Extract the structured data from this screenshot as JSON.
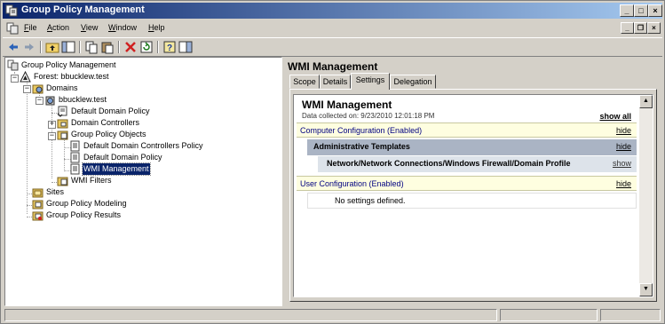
{
  "window": {
    "title": "Group Policy Management"
  },
  "menu": {
    "items": [
      "File",
      "Action",
      "View",
      "Window",
      "Help"
    ]
  },
  "tree": {
    "root": "Group Policy Management",
    "forest": "Forest: bbucklew.test",
    "domains": "Domains",
    "domain": "bbucklew.test",
    "default_domain_policy": "Default Domain Policy",
    "domain_controllers": "Domain Controllers",
    "gpo_container": "Group Policy Objects",
    "gpo_ddcp": "Default Domain Controllers Policy",
    "gpo_ddp": "Default Domain Policy",
    "gpo_wmi": "WMI Management",
    "wmi_filters": "WMI Filters",
    "sites": "Sites",
    "modeling": "Group Policy Modeling",
    "results": "Group Policy Results"
  },
  "details": {
    "title": "WMI Management",
    "tabs": [
      "Scope",
      "Details",
      "Settings",
      "Delegation"
    ],
    "active_tab": "Settings"
  },
  "report": {
    "title": "WMI Management",
    "collected": "Data collected on: 9/23/2010 12:01:18 PM",
    "show_all": "show all",
    "computer_config": "Computer Configuration (Enabled)",
    "computer_hide": "hide",
    "admin_templates": "Administrative Templates",
    "admin_hide": "hide",
    "firewall_path": "Network/Network Connections/Windows Firewall/Domain Profile",
    "firewall_show": "show",
    "user_config": "User Configuration (Enabled)",
    "user_hide": "hide",
    "no_settings": "No settings defined."
  },
  "colors": {
    "title_start": "#0a246a",
    "title_end": "#a6caf0",
    "selection": "#0a246a",
    "band_computer": "#fefee0",
    "band_admin": "#aab4c4",
    "band_firewall": "#dde3ea",
    "link_blue": "#000080"
  }
}
